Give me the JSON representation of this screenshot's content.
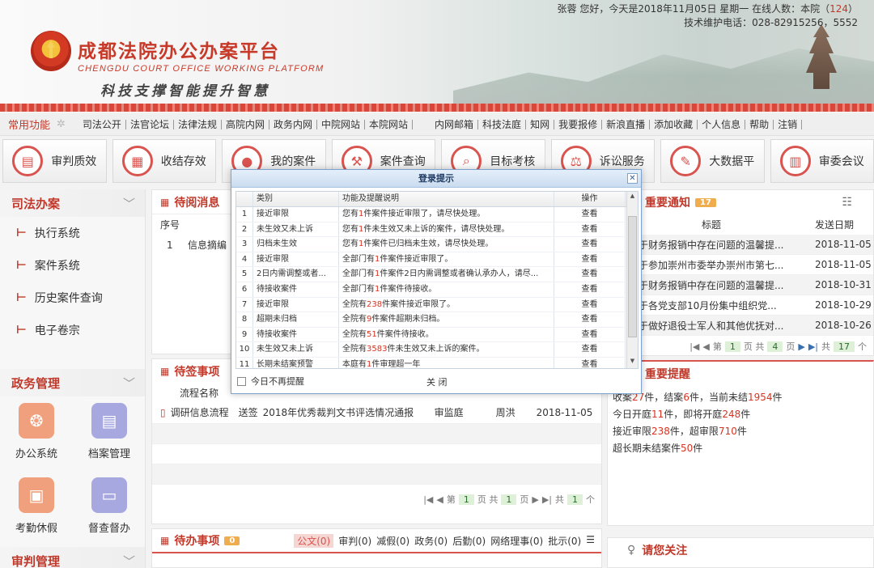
{
  "header": {
    "greeting": "张蓉 您好，今天是2018年11月05日  星期一  在线人数：本院（",
    "online_count": "124",
    "greeting_end": "）",
    "support": "技术维护电话：028-82915256，5552",
    "brand_title": "成都法院办公办案平台",
    "brand_subtitle": "CHENGDU COURT OFFICE WORKING PLATFORM",
    "slogan": "科技支撑智能提升智慧"
  },
  "navbar": {
    "fav_label": "常用功能",
    "links": [
      "司法公开",
      "法官论坛",
      "法律法规",
      "高院内网",
      "政务内网",
      "中院网站",
      "本院网站",
      "",
      "",
      "内网邮箱",
      "科技法庭",
      "知网",
      "我要报修",
      "新浪直播",
      "添加收藏",
      "个人信息",
      "帮助",
      "注销"
    ]
  },
  "modules": [
    {
      "label": "审判质效",
      "icon": "document-icon"
    },
    {
      "label": "收结存效",
      "icon": "archive-icon"
    },
    {
      "label": "我的案件",
      "icon": "user-icon"
    },
    {
      "label": "案件查询",
      "icon": "gavel-icon"
    },
    {
      "label": "目标考核",
      "icon": "search-icon"
    },
    {
      "label": "诉讼服务",
      "icon": "scale-icon"
    },
    {
      "label": "大数据平",
      "icon": "pen-icon"
    },
    {
      "label": "审委会议",
      "icon": "file-icon"
    }
  ],
  "sidebar": {
    "sections": [
      {
        "title": "司法办案",
        "items": [
          "执行系统",
          "案件系统",
          "历史案件查询",
          "电子卷宗"
        ]
      },
      {
        "title": "政务管理",
        "tiles": [
          "办公系统",
          "档案管理",
          "考勤休假",
          "督查督办"
        ]
      },
      {
        "title": "审判管理"
      }
    ]
  },
  "pending_messages": {
    "title": "待阅消息",
    "col_no": "序号",
    "rows": [
      {
        "no": "1",
        "text": "信息摘编"
      }
    ]
  },
  "pending_sign": {
    "title": "待签事项",
    "col_name": "流程名称",
    "row": {
      "flow": "调研信息流程",
      "action": "送签",
      "title": "2018年优秀裁判文书评选情况通报",
      "dept": "审监庭",
      "person": "周洪",
      "date": "2018-11-05"
    },
    "pager": {
      "page_label": "第",
      "page": "1",
      "of": "页 共",
      "total": "1",
      "suffix": "页",
      "total_label": "共",
      "count": "1",
      "count_suffix": "个"
    }
  },
  "pending_todo": {
    "title": "待办事项",
    "badge": "0",
    "tabs": [
      "公文(0)",
      "审判(0)",
      "减假(0)",
      "政务(0)",
      "后勤(0)",
      "网络理事(0)",
      "批示(0)"
    ]
  },
  "notices": {
    "title": "重要通知",
    "badge": "17",
    "col_title": "标题",
    "col_date": "发送日期",
    "rows": [
      {
        "title": "于财务报销中存在问题的温馨提...",
        "date": "2018-11-05"
      },
      {
        "title": "于参加崇州市委举办崇州市第七...",
        "date": "2018-11-05"
      },
      {
        "title": "于财务报销中存在问题的温馨提...",
        "date": "2018-10-31"
      },
      {
        "title": "于各党支部10月份集中组织党...",
        "date": "2018-10-29"
      },
      {
        "title": "于做好退役士军人和其他优抚对...",
        "date": "2018-10-26"
      }
    ],
    "pager": {
      "page_label": "第",
      "page": "1",
      "of": "页 共",
      "total": "4",
      "suffix": "页",
      "total_label": "共",
      "count": "17",
      "count_suffix": "个"
    }
  },
  "reminders": {
    "title": "重要提醒",
    "lines": [
      {
        "pre": "收案",
        "n1": "27",
        "mid": "件，结案",
        "n2": "6",
        "mid2": "件，当前未结",
        "n3": "1954",
        "post": "件"
      },
      {
        "pre": "今日开庭",
        "n1": "11",
        "mid": "件，即将开庭",
        "n2": "248",
        "post": "件"
      },
      {
        "pre": "接近审限",
        "n1": "238",
        "mid": "件，超审限",
        "n2": "710",
        "post": "件"
      },
      {
        "pre": "超长期未结案件",
        "n1": "50",
        "post": "件"
      }
    ]
  },
  "attention": {
    "title": "请您关注"
  },
  "modal": {
    "title": "登录提示",
    "headers": {
      "category": "类别",
      "desc": "功能及提醒说明",
      "op": "操作"
    },
    "rows": [
      {
        "no": "1",
        "cat": "接近审限",
        "pre": "您有",
        "n": "1",
        "post": "件案件接近审限了，请尽快处理。",
        "op": "查看"
      },
      {
        "no": "2",
        "cat": "未生效又未上诉",
        "pre": "您有",
        "n": "1",
        "post": "件未生效又未上诉的案件，请尽快处理。",
        "op": "查看"
      },
      {
        "no": "3",
        "cat": "归档未生效",
        "pre": "您有",
        "n": "1",
        "post": "件案件已归档未生效，请尽快处理。",
        "op": "查看"
      },
      {
        "no": "4",
        "cat": "接近审限",
        "pre": "全部门有",
        "n": "1",
        "post": "件案件接近审限了。",
        "op": "查看"
      },
      {
        "no": "5",
        "cat": "2日内需调整或者...",
        "pre": "全部门有",
        "n": "1",
        "post": "件案件2日内需调整或者确认承办人，请尽...",
        "op": "查看"
      },
      {
        "no": "6",
        "cat": "待接收案件",
        "pre": "全部门有",
        "n": "1",
        "post": "件案件待接收。",
        "op": "查看"
      },
      {
        "no": "7",
        "cat": "接近审限",
        "pre": "全院有",
        "n": "238",
        "post": "件案件接近审限了。",
        "op": "查看"
      },
      {
        "no": "8",
        "cat": "超期未归档",
        "pre": "全院有",
        "n": "9",
        "post": "件案件超期未归档。",
        "op": "查看"
      },
      {
        "no": "9",
        "cat": "待接收案件",
        "pre": "全院有",
        "n": "51",
        "post": "件案件待接收。",
        "op": "查看"
      },
      {
        "no": "10",
        "cat": "未生效又未上诉",
        "pre": "全院有",
        "n": "3583",
        "post": "件未生效又未上诉的案件。",
        "op": "查看"
      },
      {
        "no": "11",
        "cat": "长期未结案预警",
        "pre": "本庭有",
        "n": "1",
        "post": "件审理超一年",
        "op": "查看"
      }
    ],
    "no_remind": "今日不再提醒",
    "close": "关 闭"
  },
  "colors": {
    "accent": "#c0392b",
    "badge": "#f0ad4e",
    "modal_border": "#7da2ce"
  }
}
